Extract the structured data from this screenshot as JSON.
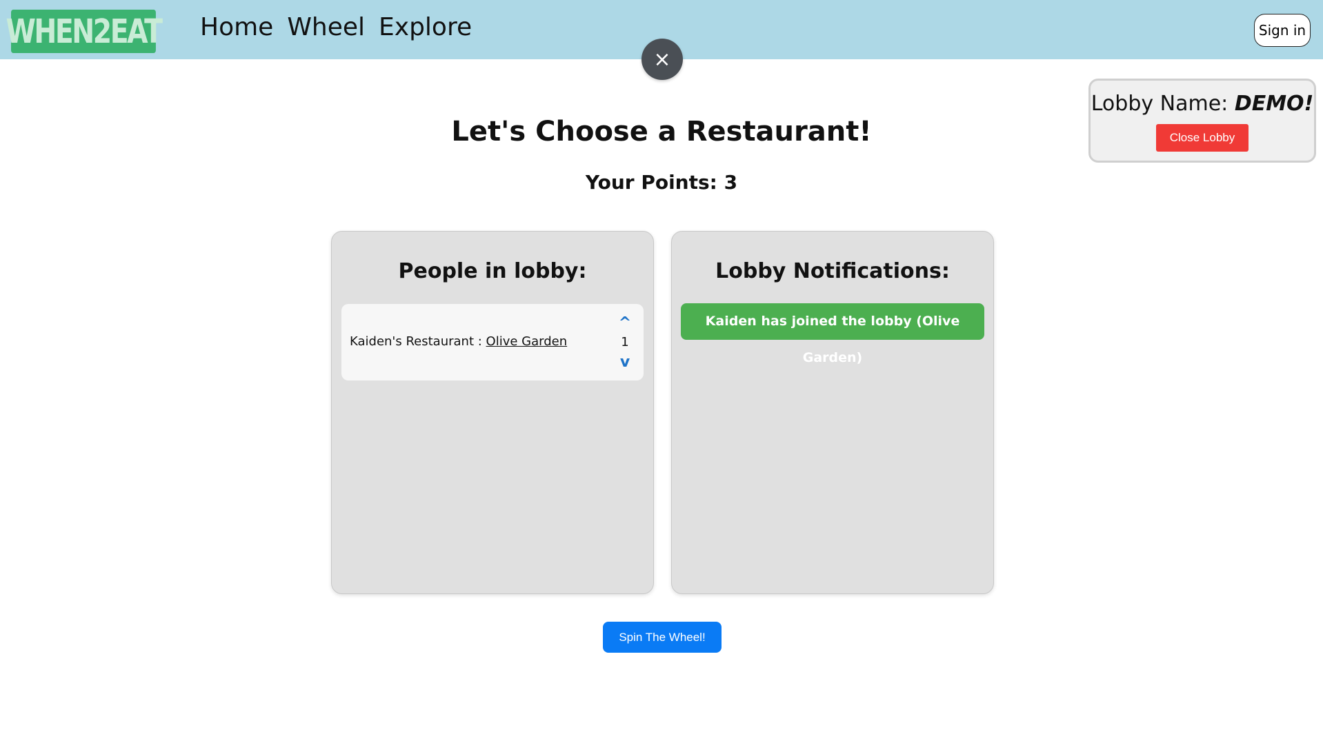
{
  "navbar": {
    "logo_text": "WHEN2EAT",
    "links": [
      {
        "label": "Home"
      },
      {
        "label": "Wheel"
      },
      {
        "label": "Explore"
      }
    ],
    "signin_label": "Sign in",
    "close_icon": "×"
  },
  "lobby": {
    "label": "Lobby Name: ",
    "name": "DEMO!",
    "close_button": "Close Lobby"
  },
  "main": {
    "title": "Let's Choose a Restaurant!",
    "points_text": "Your Points: 3"
  },
  "people_panel": {
    "title": "People in lobby:",
    "people": [
      {
        "prefix": "Kaiden's Restaurant : ",
        "restaurant": "Olive Garden",
        "votes": "1",
        "up_icon": "^",
        "down_icon": "v"
      }
    ]
  },
  "notifications_panel": {
    "title": "Lobby Notifications:",
    "items": [
      {
        "text": "Kaiden has joined the lobby (Olive Garden)"
      }
    ]
  },
  "actions": {
    "spin_label": "Spin The Wheel!"
  },
  "colors": {
    "navbar_bg": "#add8e6",
    "logo_bg": "#3cb371",
    "close_lobby_bg": "#f03a36",
    "notification_bg": "#4caf50",
    "spin_bg": "#0a7bf5",
    "vote_arrow": "#1e73c8"
  }
}
